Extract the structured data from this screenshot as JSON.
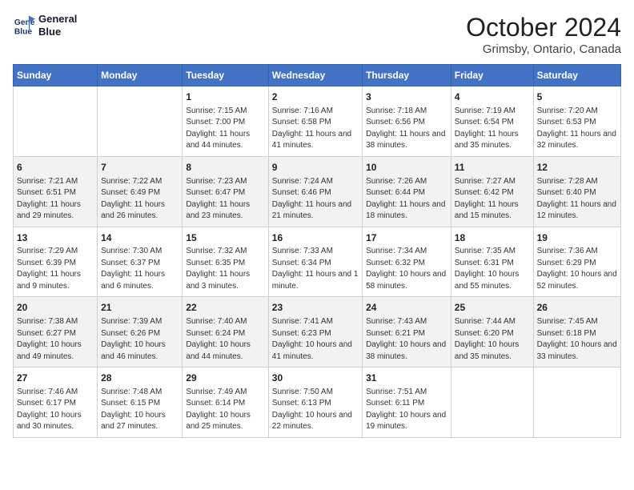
{
  "logo": {
    "line1": "General",
    "line2": "Blue"
  },
  "title": "October 2024",
  "subtitle": "Grimsby, Ontario, Canada",
  "days_of_week": [
    "Sunday",
    "Monday",
    "Tuesday",
    "Wednesday",
    "Thursday",
    "Friday",
    "Saturday"
  ],
  "weeks": [
    [
      {
        "day": "",
        "info": ""
      },
      {
        "day": "",
        "info": ""
      },
      {
        "day": "1",
        "info": "Sunrise: 7:15 AM\nSunset: 7:00 PM\nDaylight: 11 hours and 44 minutes."
      },
      {
        "day": "2",
        "info": "Sunrise: 7:16 AM\nSunset: 6:58 PM\nDaylight: 11 hours and 41 minutes."
      },
      {
        "day": "3",
        "info": "Sunrise: 7:18 AM\nSunset: 6:56 PM\nDaylight: 11 hours and 38 minutes."
      },
      {
        "day": "4",
        "info": "Sunrise: 7:19 AM\nSunset: 6:54 PM\nDaylight: 11 hours and 35 minutes."
      },
      {
        "day": "5",
        "info": "Sunrise: 7:20 AM\nSunset: 6:53 PM\nDaylight: 11 hours and 32 minutes."
      }
    ],
    [
      {
        "day": "6",
        "info": "Sunrise: 7:21 AM\nSunset: 6:51 PM\nDaylight: 11 hours and 29 minutes."
      },
      {
        "day": "7",
        "info": "Sunrise: 7:22 AM\nSunset: 6:49 PM\nDaylight: 11 hours and 26 minutes."
      },
      {
        "day": "8",
        "info": "Sunrise: 7:23 AM\nSunset: 6:47 PM\nDaylight: 11 hours and 23 minutes."
      },
      {
        "day": "9",
        "info": "Sunrise: 7:24 AM\nSunset: 6:46 PM\nDaylight: 11 hours and 21 minutes."
      },
      {
        "day": "10",
        "info": "Sunrise: 7:26 AM\nSunset: 6:44 PM\nDaylight: 11 hours and 18 minutes."
      },
      {
        "day": "11",
        "info": "Sunrise: 7:27 AM\nSunset: 6:42 PM\nDaylight: 11 hours and 15 minutes."
      },
      {
        "day": "12",
        "info": "Sunrise: 7:28 AM\nSunset: 6:40 PM\nDaylight: 11 hours and 12 minutes."
      }
    ],
    [
      {
        "day": "13",
        "info": "Sunrise: 7:29 AM\nSunset: 6:39 PM\nDaylight: 11 hours and 9 minutes."
      },
      {
        "day": "14",
        "info": "Sunrise: 7:30 AM\nSunset: 6:37 PM\nDaylight: 11 hours and 6 minutes."
      },
      {
        "day": "15",
        "info": "Sunrise: 7:32 AM\nSunset: 6:35 PM\nDaylight: 11 hours and 3 minutes."
      },
      {
        "day": "16",
        "info": "Sunrise: 7:33 AM\nSunset: 6:34 PM\nDaylight: 11 hours and 1 minute."
      },
      {
        "day": "17",
        "info": "Sunrise: 7:34 AM\nSunset: 6:32 PM\nDaylight: 10 hours and 58 minutes."
      },
      {
        "day": "18",
        "info": "Sunrise: 7:35 AM\nSunset: 6:31 PM\nDaylight: 10 hours and 55 minutes."
      },
      {
        "day": "19",
        "info": "Sunrise: 7:36 AM\nSunset: 6:29 PM\nDaylight: 10 hours and 52 minutes."
      }
    ],
    [
      {
        "day": "20",
        "info": "Sunrise: 7:38 AM\nSunset: 6:27 PM\nDaylight: 10 hours and 49 minutes."
      },
      {
        "day": "21",
        "info": "Sunrise: 7:39 AM\nSunset: 6:26 PM\nDaylight: 10 hours and 46 minutes."
      },
      {
        "day": "22",
        "info": "Sunrise: 7:40 AM\nSunset: 6:24 PM\nDaylight: 10 hours and 44 minutes."
      },
      {
        "day": "23",
        "info": "Sunrise: 7:41 AM\nSunset: 6:23 PM\nDaylight: 10 hours and 41 minutes."
      },
      {
        "day": "24",
        "info": "Sunrise: 7:43 AM\nSunset: 6:21 PM\nDaylight: 10 hours and 38 minutes."
      },
      {
        "day": "25",
        "info": "Sunrise: 7:44 AM\nSunset: 6:20 PM\nDaylight: 10 hours and 35 minutes."
      },
      {
        "day": "26",
        "info": "Sunrise: 7:45 AM\nSunset: 6:18 PM\nDaylight: 10 hours and 33 minutes."
      }
    ],
    [
      {
        "day": "27",
        "info": "Sunrise: 7:46 AM\nSunset: 6:17 PM\nDaylight: 10 hours and 30 minutes."
      },
      {
        "day": "28",
        "info": "Sunrise: 7:48 AM\nSunset: 6:15 PM\nDaylight: 10 hours and 27 minutes."
      },
      {
        "day": "29",
        "info": "Sunrise: 7:49 AM\nSunset: 6:14 PM\nDaylight: 10 hours and 25 minutes."
      },
      {
        "day": "30",
        "info": "Sunrise: 7:50 AM\nSunset: 6:13 PM\nDaylight: 10 hours and 22 minutes."
      },
      {
        "day": "31",
        "info": "Sunrise: 7:51 AM\nSunset: 6:11 PM\nDaylight: 10 hours and 19 minutes."
      },
      {
        "day": "",
        "info": ""
      },
      {
        "day": "",
        "info": ""
      }
    ]
  ]
}
